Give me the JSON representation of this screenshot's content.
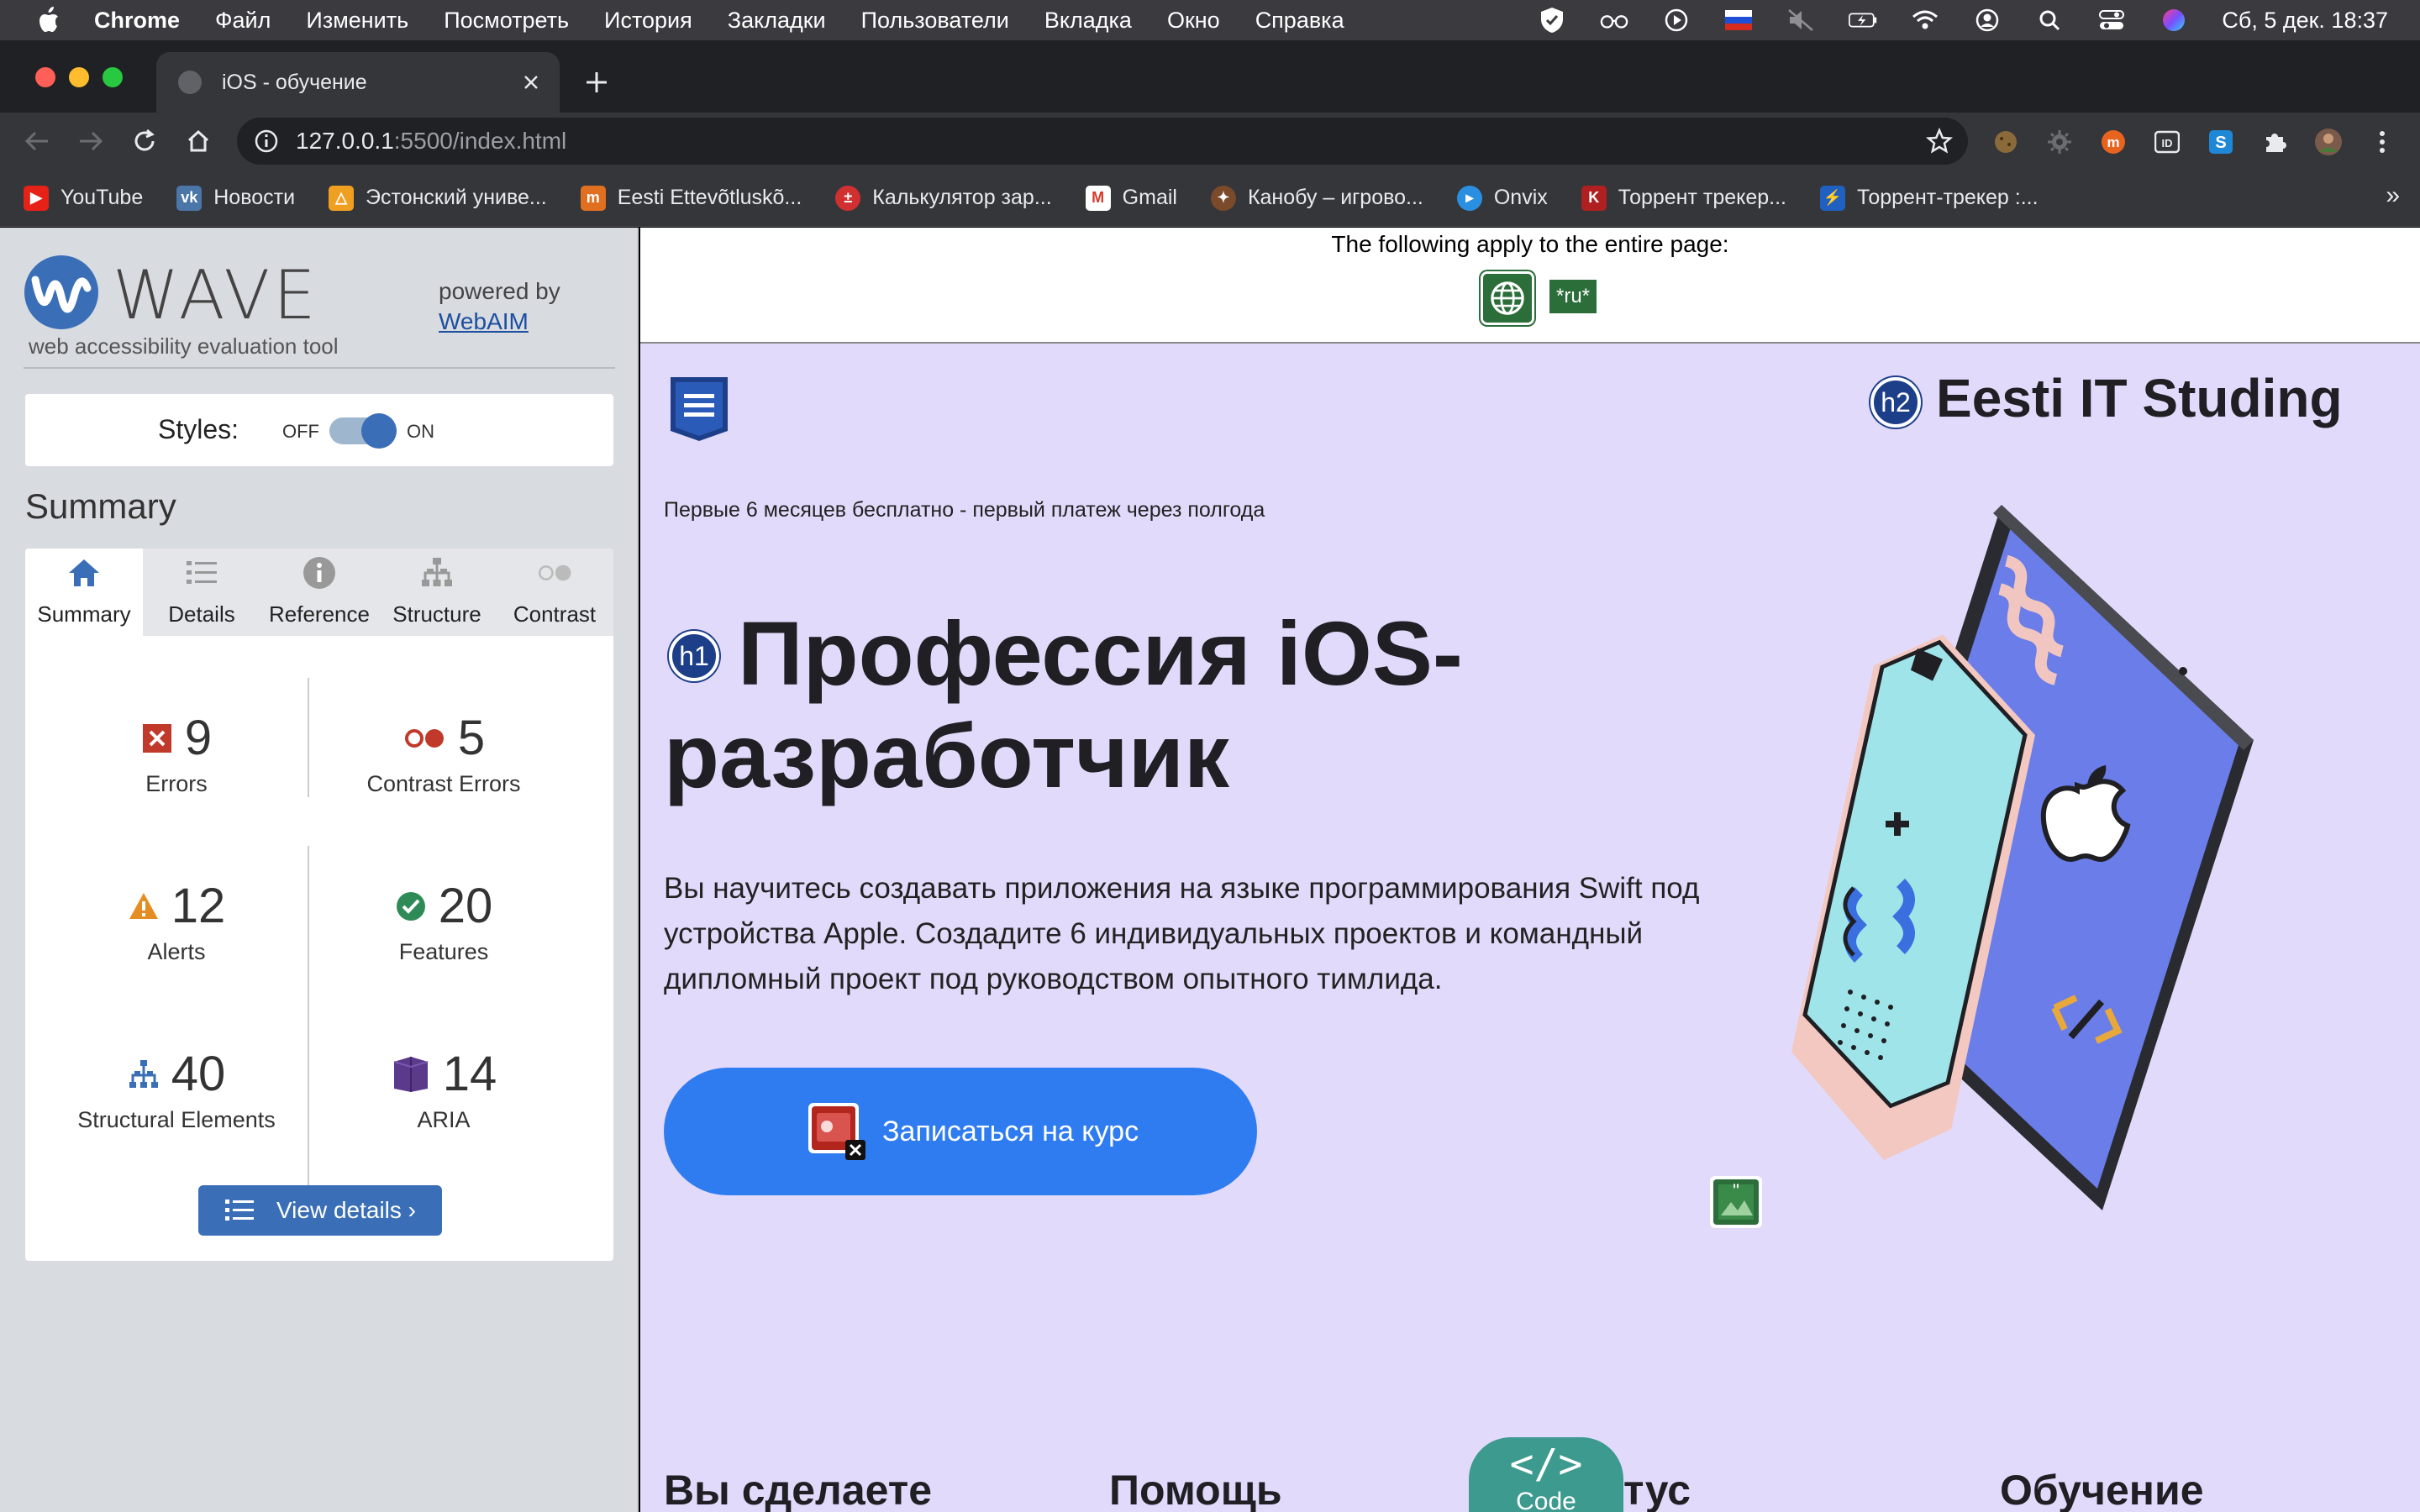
{
  "menubar": {
    "app": "Chrome",
    "items": [
      "Файл",
      "Изменить",
      "Посмотреть",
      "История",
      "Закладки",
      "Пользователи",
      "Вкладка",
      "Окно",
      "Справка"
    ],
    "clock": "Сб, 5 дек.  18:37"
  },
  "tab": {
    "title": "iOS - обучение"
  },
  "address": {
    "host": "127.0.0.1",
    "path": ":5500/index.html"
  },
  "bookmarks": [
    {
      "label": "YouTube",
      "color": "#e62117",
      "glyph": "▶"
    },
    {
      "label": "Новости",
      "color": "#4a76a8",
      "glyph": "vk"
    },
    {
      "label": "Эстонский униве...",
      "color": "#f0a020",
      "glyph": "△"
    },
    {
      "label": "Eesti Ettevõtluskõ...",
      "color": "#e07020",
      "glyph": "m"
    },
    {
      "label": "Калькулятор зар...",
      "color": "#d03030",
      "glyph": "±"
    },
    {
      "label": "Gmail",
      "color": "#d33b2c",
      "glyph": "M"
    },
    {
      "label": "Канобу – игрово...",
      "color": "#7a4a2a",
      "glyph": "✦"
    },
    {
      "label": "Onvix",
      "color": "#2a8fe0",
      "glyph": "▸"
    },
    {
      "label": "Торрент трекер...",
      "color": "#b02020",
      "glyph": "K"
    },
    {
      "label": "Торрент-трекер :...",
      "color": "#2060c0",
      "glyph": "⚡"
    }
  ],
  "wave": {
    "logo_text": "WAVE",
    "tagline": "web accessibility evaluation tool",
    "powered_by": "powered by",
    "webaim": "WebAIM",
    "styles_label": "Styles:",
    "off": "OFF",
    "on": "ON",
    "summary_heading": "Summary",
    "tabs": [
      "Summary",
      "Details",
      "Reference",
      "Structure",
      "Contrast"
    ],
    "stats": {
      "errors": {
        "value": "9",
        "label": "Errors"
      },
      "contrast": {
        "value": "5",
        "label": "Contrast Errors"
      },
      "alerts": {
        "value": "12",
        "label": "Alerts"
      },
      "features": {
        "value": "20",
        "label": "Features"
      },
      "structural": {
        "value": "40",
        "label": "Structural Elements"
      },
      "aria": {
        "value": "14",
        "label": "ARIA"
      }
    },
    "view_details": "View details ›"
  },
  "page": {
    "applies": "The following apply to the entire page:",
    "lang_badge": "*ru*",
    "h2_badge": "h2",
    "brand": "Eesti IT Studing",
    "promo": "Первые 6 месяцев бесплатно - первый платеж через полгода",
    "h1_badge": "h1",
    "hero_line1": "Профессия iOS-",
    "hero_line2": "разработчик",
    "description": "Вы научитесь создавать приложения на языке программирования Swift под устройства Apple. Создадите 6 индивидуальных проектов и командный дипломный проект под руководством опытного тимлида.",
    "cta": "Записаться на курс",
    "sections": [
      "Вы сделаете",
      "Помощь",
      "тус",
      "Обучение"
    ],
    "code_label": "Code",
    "code_glyph": "</>"
  },
  "colors": {
    "page_bg": "#e2dafb",
    "cta": "#2f7cf0",
    "wave_blue": "#3a6fb8",
    "error_red": "#c0392b"
  }
}
